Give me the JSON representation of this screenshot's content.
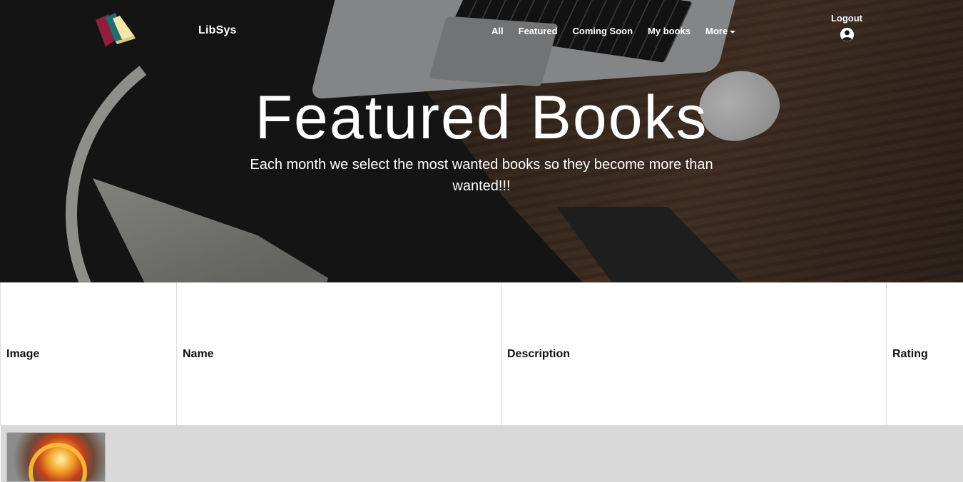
{
  "nav": {
    "brand": "LibSys",
    "links": [
      {
        "label": "All"
      },
      {
        "label": "Featured"
      },
      {
        "label": "Coming Soon"
      },
      {
        "label": "My books"
      },
      {
        "label": "More"
      }
    ],
    "logout_label": "Logout",
    "user_icon": "user-circle-icon",
    "logo_icon": "books-logo-icon"
  },
  "hero": {
    "title": "Featured Books",
    "subtitle": "Each month we select the most wanted books so they become more than wanted!!!"
  },
  "table": {
    "columns": [
      "Image",
      "Name",
      "Description",
      "Rating"
    ],
    "rows": [
      {
        "image_icon": "book-cover-image",
        "name": "",
        "description": "",
        "rating": ""
      }
    ]
  },
  "colors": {
    "hero_overlay": "#1c1c1c",
    "nav_text": "#ffffff",
    "row_background": "#d9d9d9",
    "table_border": "#dddddd"
  }
}
